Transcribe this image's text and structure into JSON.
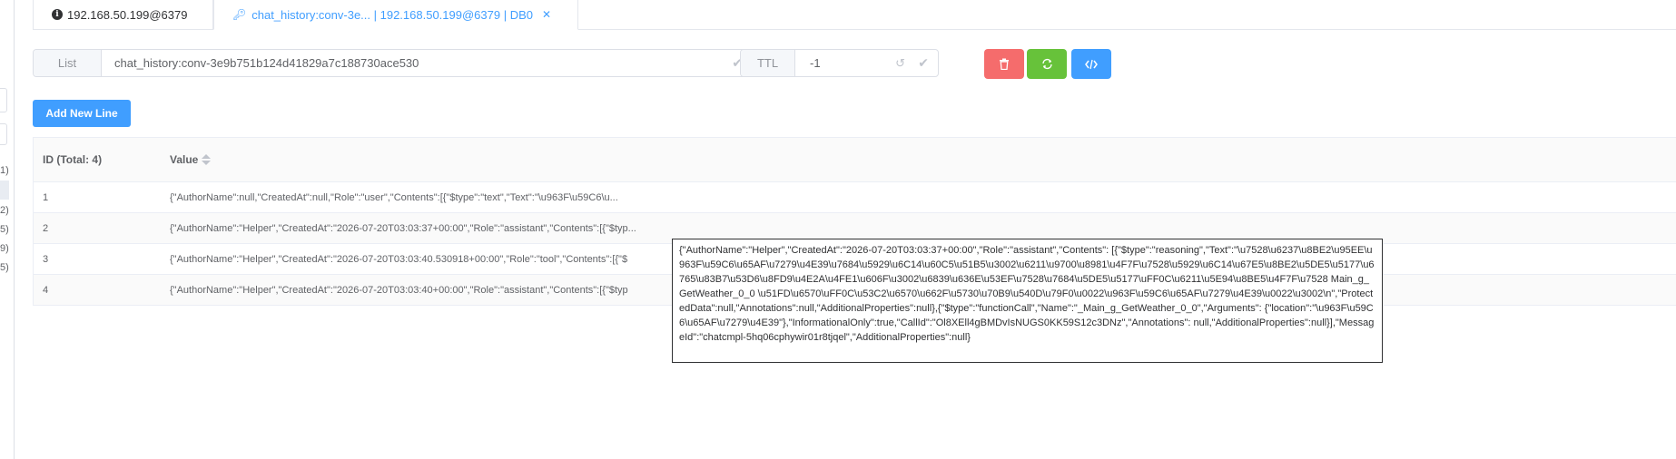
{
  "sidebar": {
    "fragments": [
      "1)",
      "2)",
      "5)",
      "9)",
      "5)"
    ]
  },
  "tabs": [
    {
      "label": "192.168.50.199@6379"
    },
    {
      "label": "chat_history:conv-3e... | 192.168.50.199@6379 | DB0"
    }
  ],
  "key": {
    "type_label": "List",
    "name": "chat_history:conv-3e9b751b124d41829a7c188730ace530",
    "ttl_label": "TTL",
    "ttl_value": "-1"
  },
  "toolbar": {
    "add_line_label": "Add New Line"
  },
  "table": {
    "id_header": "ID (Total: 4)",
    "value_header": "Value",
    "rows": [
      {
        "id": "1",
        "value": "{\"AuthorName\":null,\"CreatedAt\":null,\"Role\":\"user\",\"Contents\":[{\"$type\":\"text\",\"Text\":\"\\u963F\\u59C6\\u..."
      },
      {
        "id": "2",
        "value": "{\"AuthorName\":\"Helper\",\"CreatedAt\":\"2026-07-20T03:03:37+00:00\",\"Role\":\"assistant\",\"Contents\":[{\"$typ..."
      },
      {
        "id": "3",
        "value": "{\"AuthorName\":\"Helper\",\"CreatedAt\":\"2026-07-20T03:03:40.530918+00:00\",\"Role\":\"tool\",\"Contents\":[{\"$"
      },
      {
        "id": "4",
        "value": "{\"AuthorName\":\"Helper\",\"CreatedAt\":\"2026-07-20T03:03:40+00:00\",\"Role\":\"assistant\",\"Contents\":[{\"$typ"
      }
    ]
  },
  "tooltip": {
    "text": "{\"AuthorName\":\"Helper\",\"CreatedAt\":\"2026-07-20T03:03:37+00:00\",\"Role\":\"assistant\",\"Contents\": [{\"$type\":\"reasoning\",\"Text\":\"\\u7528\\u6237\\u8BE2\\u95EE\\u963F\\u59C6\\u65AF\\u7279\\u4E39\\u7684\\u5929\\u6C14\\u60C5\\u51B5\\u3002\\u6211\\u9700\\u8981\\u4F7F\\u7528\\u5929\\u6C14\\u67E5\\u8BE2\\u5DE5\\u5177\\u6765\\u83B7\\u53D6\\u8FD9\\u4E2A\\u4FE1\\u606F\\u3002\\u6839\\u636E\\u53EF\\u7528\\u7684\\u5DE5\\u5177\\uFF0C\\u6211\\u5E94\\u8BE5\\u4F7F\\u7528 Main_g_GetWeather_0_0 \\u51FD\\u6570\\uFF0C\\u53C2\\u6570\\u662F\\u5730\\u70B9\\u540D\\u79F0\\u0022\\u963F\\u59C6\\u65AF\\u7279\\u4E39\\u0022\\u3002\\n\",\"ProtectedData\":null,\"Annotations\":null,\"AdditionalProperties\":null},{\"$type\":\"functionCall\",\"Name\":\"_Main_g_GetWeather_0_0\",\"Arguments\": {\"location\":\"\\u963F\\u59C6\\u65AF\\u7279\\u4E39\"},\"InformationalOnly\":true,\"CallId\":\"Ol8XEll4gBMDvIsNUGS0KK59S12c3DNz\",\"Annotations\": null,\"AdditionalProperties\":null}],\"MessageId\":\"chatcmpl-5hq06cphywir01r8tjqel\",\"AdditionalProperties\":null}"
  }
}
